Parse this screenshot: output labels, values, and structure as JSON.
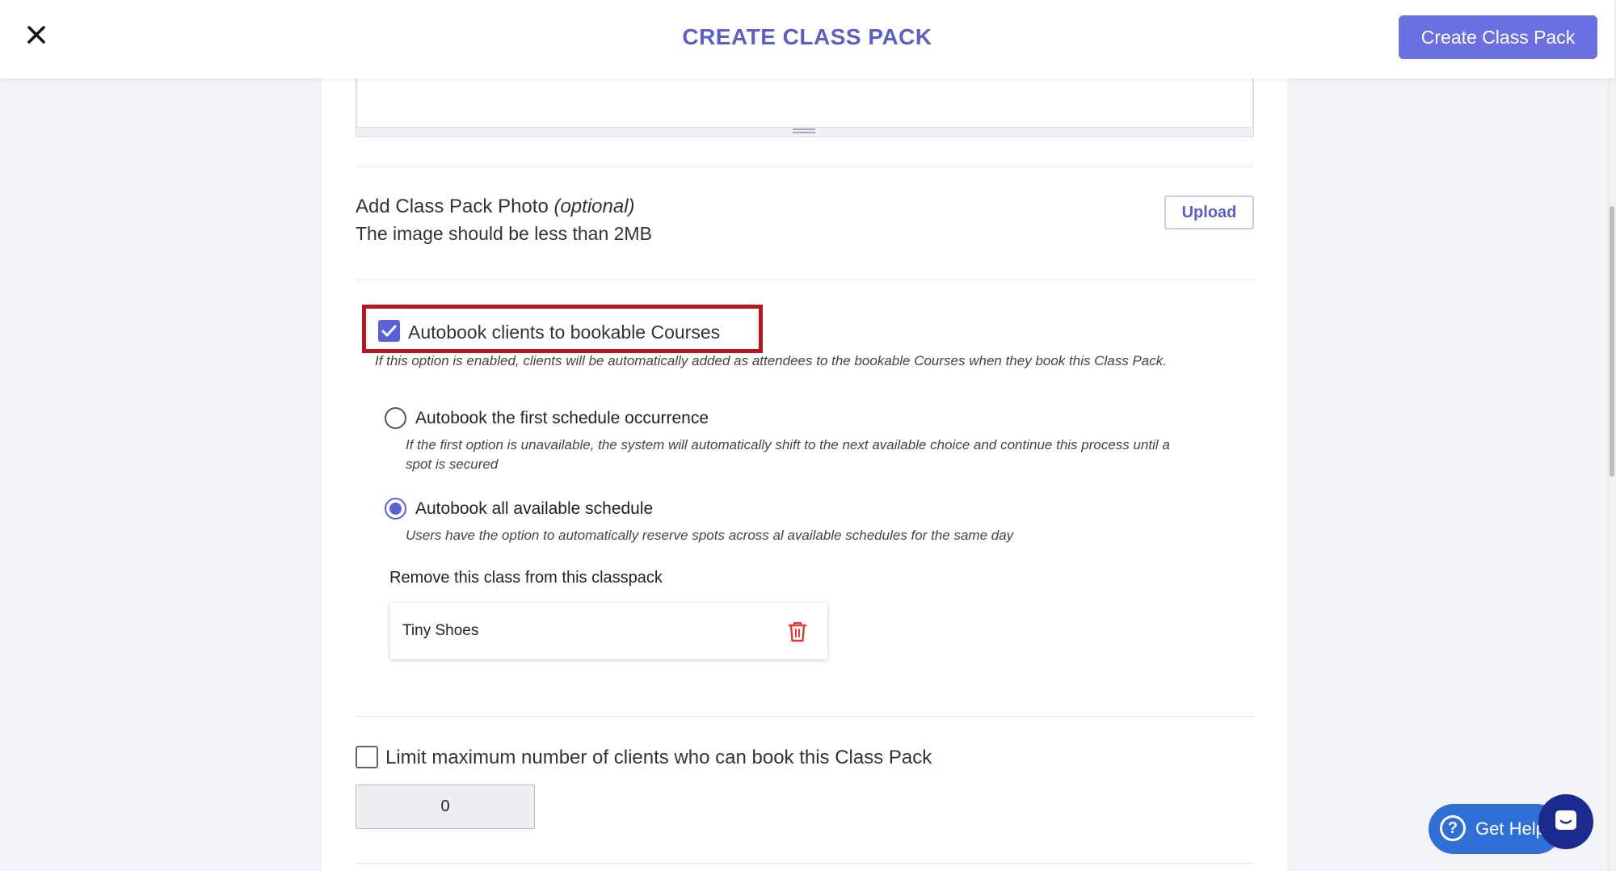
{
  "header": {
    "title": "CREATE CLASS PACK",
    "create_button": "Create Class Pack",
    "close_icon": "close-icon"
  },
  "photo": {
    "title": "Add Class Pack Photo",
    "optional": "(optional)",
    "subtitle": "The image should be less than 2MB",
    "upload_button": "Upload"
  },
  "autobook": {
    "checked": true,
    "label": "Autobook clients to bookable Courses",
    "note": "If this option is enabled, clients will be automatically added as attendees to the bookable Courses when they book this Class Pack.",
    "options": [
      {
        "label": "Autobook the first schedule occurrence",
        "note_line1": "If the first option is unavailable, the system will automatically shift to the next available choice and continue this process until a",
        "note_line2": "spot is secured",
        "selected": false
      },
      {
        "label": "Autobook all available schedule",
        "note_line1": "Users have the option to automatically reserve spots across al available schedules for the same day",
        "selected": true
      }
    ],
    "remove_title": "Remove this class from this classpack",
    "classes": [
      {
        "name": "Tiny Shoes"
      }
    ]
  },
  "limit": {
    "checked": false,
    "label": "Limit maximum number of clients who can book this Class Pack",
    "value": "0"
  },
  "help": {
    "label": "Get Help",
    "icon": "question-icon",
    "chat_icon": "chat-icon"
  },
  "colors": {
    "accent": "#6b70e0",
    "title": "#5b5fc7",
    "highlight": "#b3191e",
    "trash": "#e53935",
    "help": "#2f6fd6",
    "chat": "#1b2a8f"
  }
}
